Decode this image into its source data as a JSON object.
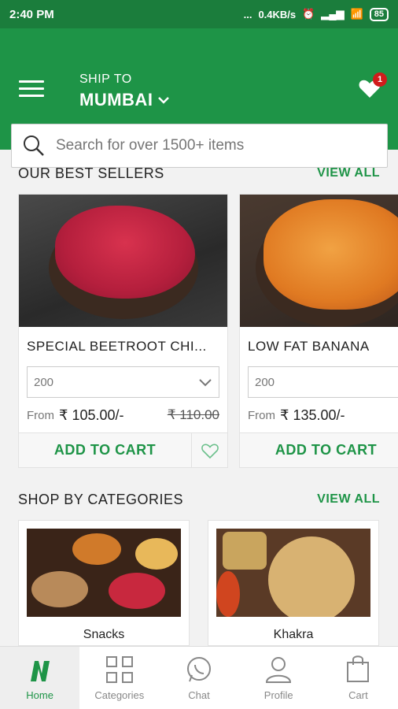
{
  "status_bar": {
    "time": "2:40 PM",
    "dots": "...",
    "speed": "0.4KB/s",
    "battery": "85"
  },
  "header": {
    "ship_to_label": "SHIP TO",
    "city": "MUMBAI",
    "wishlist_count": "1"
  },
  "search": {
    "placeholder": "Search for over 1500+ items"
  },
  "best_sellers": {
    "title": "OUR BEST SELLERS",
    "view_all": "VIEW ALL",
    "products": [
      {
        "name": "SPECIAL BEETROOT CHI...",
        "weight": "200",
        "from_label": "From",
        "price": "₹ 105.00/-",
        "old_price": "₹ 110.00",
        "cta": "ADD TO CART"
      },
      {
        "name": "LOW FAT BANANA",
        "weight": "200",
        "from_label": "From",
        "price": "₹ 135.00/-",
        "cta": "ADD TO CART"
      }
    ]
  },
  "categories": {
    "title": "SHOP BY CATEGORIES",
    "view_all": "VIEW ALL",
    "items": [
      {
        "name": "Snacks"
      },
      {
        "name": "Khakra"
      }
    ]
  },
  "bottom_nav": [
    {
      "label": "Home"
    },
    {
      "label": "Categories"
    },
    {
      "label": "Chat"
    },
    {
      "label": "Profile"
    },
    {
      "label": "Cart"
    }
  ],
  "colors": {
    "brand": "#1e9447",
    "status_bar": "#1b7d3c",
    "badge": "#d11c1c"
  }
}
